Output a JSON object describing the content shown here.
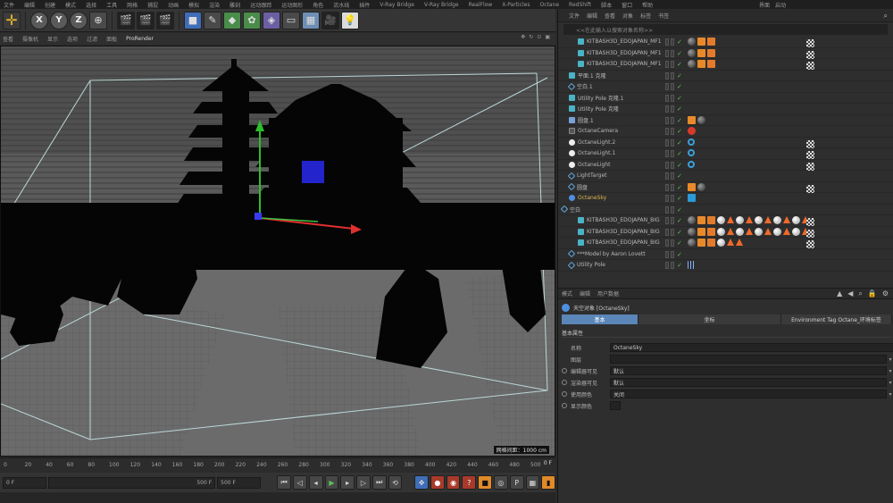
{
  "menubar": {
    "items": [
      "文件",
      "编辑",
      "创建",
      "模式",
      "选择",
      "工具",
      "网格",
      "捕捉",
      "动画",
      "模拟",
      "渲染",
      "雕刻",
      "运动跟踪",
      "运动图形",
      "角色",
      "流水线",
      "插件",
      "V-Ray Bridge",
      "V-Ray Bridge",
      "RealFlow",
      "X-Particles",
      "Octane",
      "RedShift",
      "脚本",
      "窗口",
      "帮助"
    ],
    "layout_label": "界面",
    "layout_value": "启动"
  },
  "toolbar": {
    "axis_labels": [
      "X",
      "Y",
      "Z"
    ]
  },
  "viewport_menu": {
    "items": [
      "查看",
      "摄像机",
      "显示",
      "选项",
      "过滤",
      "面板",
      "ProRender"
    ]
  },
  "viewport": {
    "grid_label": "网格间距：1000 cm"
  },
  "timeline": {
    "ticks": [
      "0",
      "20",
      "40",
      "60",
      "80",
      "100",
      "120",
      "140",
      "160",
      "180",
      "200",
      "220",
      "240",
      "260",
      "280",
      "300",
      "320",
      "340",
      "360",
      "380",
      "400",
      "420",
      "440",
      "460",
      "480",
      "500"
    ],
    "current_frame": "0 F",
    "start_field": "0 F",
    "end_field": "500 F",
    "max_field": "500 F"
  },
  "object_manager": {
    "menu": [
      "文件",
      "编辑",
      "查看",
      "对象",
      "标签",
      "书签"
    ],
    "search_placeholder": "<<在此输入以搜索对象名称>>",
    "objects": [
      {
        "name": "KITBASH3D_EDOJAPAN_MF1",
        "icon": "cloner",
        "tags": [
          "mat",
          "chk",
          "orange",
          "oct"
        ],
        "highlight": false
      },
      {
        "name": "KITBASH3D_EDOJAPAN_MF1",
        "icon": "cloner",
        "tags": [
          "mat",
          "chk",
          "orange",
          "oct"
        ],
        "highlight": false
      },
      {
        "name": "KITBASH3D_EDOJAPAN_MF1",
        "icon": "cloner",
        "tags": [
          "mat",
          "chk",
          "orange",
          "oct"
        ],
        "highlight": false
      },
      {
        "name": "平面.1 克隆",
        "icon": "cloner",
        "tags": [],
        "highlight": false
      },
      {
        "name": "空白.1",
        "icon": "null",
        "tags": [],
        "highlight": false
      },
      {
        "name": "Utility Pole 克隆.1",
        "icon": "cloner",
        "tags": [],
        "highlight": false
      },
      {
        "name": "Utility Pole 克隆",
        "icon": "cloner",
        "tags": [],
        "highlight": false
      },
      {
        "name": "圆盘.1",
        "icon": "obj",
        "tags": [
          "orange",
          "mat"
        ],
        "highlight": false
      },
      {
        "name": "OctaneCamera",
        "icon": "cam",
        "tags": [
          "red"
        ],
        "highlight": false
      },
      {
        "name": "OctaneLight.2",
        "icon": "light",
        "tags": [
          "chk",
          "ring"
        ],
        "highlight": false
      },
      {
        "name": "OctaneLight.1",
        "icon": "light",
        "tags": [
          "chk",
          "ring"
        ],
        "highlight": false
      },
      {
        "name": "OctaneLight",
        "icon": "light",
        "tags": [
          "chk",
          "ring"
        ],
        "highlight": false
      },
      {
        "name": "LightTarget",
        "icon": "null",
        "tags": [],
        "highlight": false
      },
      {
        "name": "圆盘",
        "icon": "null",
        "tags": [
          "orange",
          "chk",
          "mat"
        ],
        "highlight": false
      },
      {
        "name": "OctaneSky",
        "icon": "sky",
        "tags": [
          "blue"
        ],
        "highlight": true
      },
      {
        "name": "空白",
        "icon": "null",
        "tags": [],
        "highlight": false
      },
      {
        "name": "KITBASH3D_EDOJAPAN_BIG",
        "icon": "cloner",
        "tags": [
          "mat",
          "chk",
          "orange",
          "oct",
          "mat2",
          "tri",
          "mat2",
          "tri",
          "mat2",
          "tri",
          "mat2",
          "tri",
          "mat2",
          "tri"
        ],
        "highlight": false
      },
      {
        "name": "KITBASH3D_EDOJAPAN_BIG",
        "icon": "cloner",
        "tags": [
          "mat",
          "chk",
          "orange",
          "oct",
          "mat2",
          "tri",
          "mat2",
          "tri",
          "mat2",
          "tri",
          "mat2",
          "tri",
          "mat2",
          "tri"
        ],
        "highlight": false
      },
      {
        "name": "KITBASH3D_EDOJAPAN_BIG",
        "icon": "cloner",
        "tags": [
          "mat",
          "chk",
          "orange",
          "oct",
          "mat2",
          "tri",
          "tri"
        ],
        "highlight": false
      },
      {
        "name": "***Model by Aaron Lovett",
        "icon": "null",
        "tags": [],
        "highlight": false
      },
      {
        "name": "Utility Pole",
        "icon": "null",
        "tags": [
          "dots"
        ],
        "highlight": false
      }
    ]
  },
  "attribute_manager": {
    "menu": [
      "模式",
      "编辑",
      "用户数据"
    ],
    "header": "天空对象 [OctaneSky]",
    "tabs": [
      "基本",
      "坐标",
      "Environment Tag Octane_环境标签"
    ],
    "section": "基本属性",
    "fields": [
      {
        "label": "名称",
        "value": "OctaneSky",
        "radio": false
      },
      {
        "label": "图层",
        "value": "",
        "radio": false
      },
      {
        "label": "编辑器可见",
        "value": "默认",
        "radio": true
      },
      {
        "label": "渲染器可见",
        "value": "默认",
        "radio": true
      },
      {
        "label": "使用颜色",
        "value": "关闭",
        "radio": true
      },
      {
        "label": "显示颜色",
        "value": "",
        "radio": true
      }
    ]
  },
  "colors": {
    "accent": "#5a86b8",
    "highlight": "#e0b64e",
    "viewport_bg": "#1a1a1a"
  }
}
